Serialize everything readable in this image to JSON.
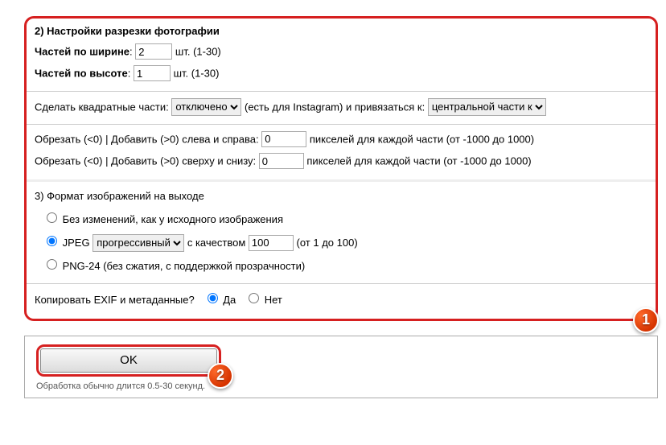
{
  "section2": {
    "title": "2) Настройки разрезки фотографии",
    "widthParts": {
      "label": "Частей по ширине",
      "value": "2",
      "unit": "шт. (1-30)"
    },
    "heightParts": {
      "label": "Частей по высоте",
      "value": "1",
      "unit": "шт. (1-30)"
    },
    "square": {
      "label": "Сделать квадратные части:",
      "select": "отключено",
      "note": "(есть для Instagram) и привязаться к:",
      "bindSelect": "центральной части к"
    },
    "crop": {
      "line1_a": "Обрезать (<0) | Добавить (>0) слева и справа:",
      "line1_val": "0",
      "line1_b": "пикселей для каждой части (от -1000 до 1000)",
      "line2_a": "Обрезать (<0) | Добавить (>0) сверху и снизу:",
      "line2_val": "0",
      "line2_b": "пикселей для каждой части (от -1000 до 1000)"
    }
  },
  "section3": {
    "title": "3) Формат изображений на выходе",
    "optNoChange": "Без изменений, как у исходного изображения",
    "optJpeg": "JPEG",
    "jpegMode": "прогрессивный",
    "jpegQualLabel": "с качеством",
    "jpegQualVal": "100",
    "jpegRange": "(от 1 до 100)",
    "optPng": "PNG-24 (без сжатия, с поддержкой прозрачности)",
    "exif": {
      "label": "Копировать EXIF и метаданные?",
      "yes": "Да",
      "no": "Нет"
    }
  },
  "bottom": {
    "ok": "OK",
    "hint": "Обработка обычно длится 0.5-30 секунд."
  },
  "badges": {
    "one": "1",
    "two": "2"
  }
}
